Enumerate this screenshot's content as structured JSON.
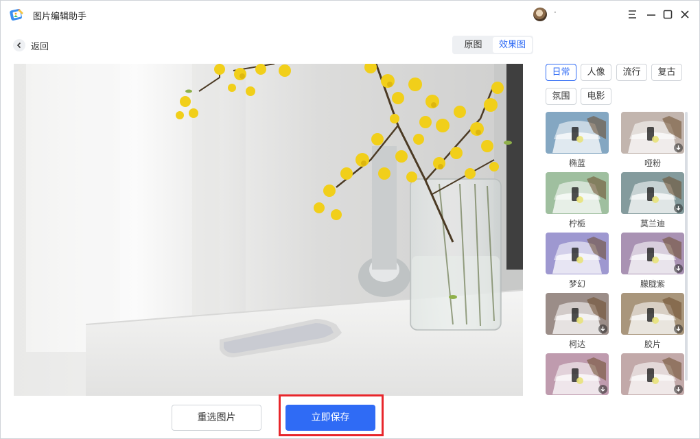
{
  "app": {
    "title": "图片编辑助手",
    "username": "·"
  },
  "nav": {
    "back_label": "返回"
  },
  "view_toggle": {
    "original_label": "原图",
    "effect_label": "效果图",
    "active": "效果图"
  },
  "filter_categories": [
    {
      "label": "日常",
      "active": true
    },
    {
      "label": "人像",
      "active": false
    },
    {
      "label": "流行",
      "active": false
    },
    {
      "label": "复古",
      "active": false
    },
    {
      "label": "氛围",
      "active": false
    },
    {
      "label": "电影",
      "active": false
    }
  ],
  "filters": [
    {
      "label": "椭蓝",
      "tint": "#6f98b8",
      "download": false
    },
    {
      "label": "哑粉",
      "tint": "#b8a8a0",
      "download": true
    },
    {
      "label": "柠栀",
      "tint": "#8fb48f",
      "download": false
    },
    {
      "label": "莫兰迪",
      "tint": "#6f8a8c",
      "download": true
    },
    {
      "label": "梦幻",
      "tint": "#8e86c8",
      "download": false
    },
    {
      "label": "朦胧紫",
      "tint": "#9a7fa6",
      "download": true
    },
    {
      "label": "柯达",
      "tint": "#8a7a74",
      "download": true
    },
    {
      "label": "胶片",
      "tint": "#9a8466",
      "download": true
    },
    {
      "label": "",
      "tint": "#b48aa0",
      "download": true
    },
    {
      "label": "",
      "tint": "#b89a9a",
      "download": true
    }
  ],
  "actions": {
    "reselect_label": "重选图片",
    "save_label": "立即保存"
  },
  "colors": {
    "accent": "#2f6bf5",
    "highlight_border": "#e8262b"
  }
}
